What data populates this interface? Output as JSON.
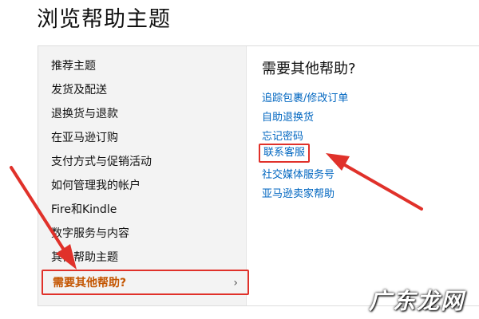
{
  "page_title": "浏览帮助主题",
  "sidebar": {
    "items": [
      {
        "label": "推荐主题"
      },
      {
        "label": "发货及配送"
      },
      {
        "label": "退换货与退款"
      },
      {
        "label": "在亚马逊订购"
      },
      {
        "label": "支付方式与促销活动"
      },
      {
        "label": "如何管理我的帐户"
      },
      {
        "label": "Fire和Kindle"
      },
      {
        "label": "数字服务与内容"
      },
      {
        "label": "其他帮助主题"
      },
      {
        "label": "需要其他帮助?",
        "selected": true,
        "chevron": "›"
      }
    ]
  },
  "help_panel": {
    "heading": "需要其他帮助?",
    "links": [
      {
        "label": "追踪包裹/修改订单"
      },
      {
        "label": "自助退换货"
      },
      {
        "label": "忘记密码"
      },
      {
        "label": "联系客服",
        "highlighted": true
      },
      {
        "label": "社交媒体服务号"
      },
      {
        "label": "亚马逊卖家帮助"
      }
    ]
  },
  "watermark": "广东龙网",
  "colors": {
    "accent_orange": "#c45500",
    "link_blue": "#0066c0",
    "annotation_red": "#e0312a",
    "sidebar_bg": "#f3f3f3"
  }
}
